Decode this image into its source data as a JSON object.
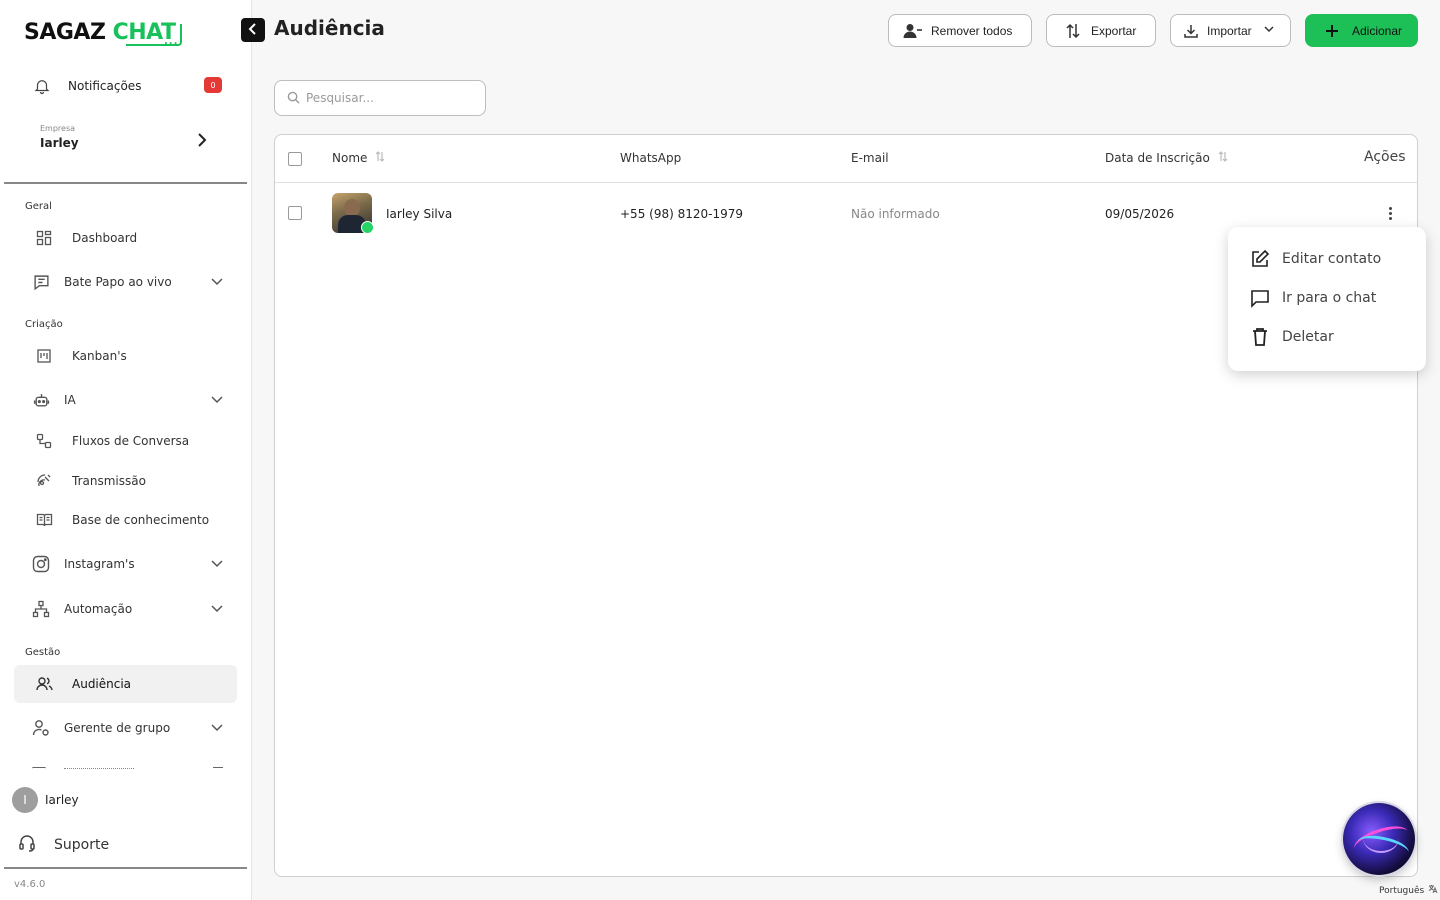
{
  "logo": {
    "part1": "SAGAZ",
    "part2": "CHAT",
    "dots": "..."
  },
  "notifications": {
    "label": "Notificações",
    "count": "0"
  },
  "company": {
    "caption": "Empresa",
    "name": "Iarley"
  },
  "sidebar": {
    "sections": {
      "geral": "Geral",
      "criacao": "Criação",
      "gestao": "Gestão"
    },
    "items": [
      {
        "label": "Dashboard",
        "icon": "dashboard-grid-icon"
      },
      {
        "label": "Bate Papo ao vivo",
        "icon": "chat-icon"
      },
      {
        "label": "Kanban's",
        "icon": "kanban-icon"
      },
      {
        "label": "IA",
        "icon": "robot-icon"
      },
      {
        "label": "Fluxos de Conversa",
        "icon": "flow-icon"
      },
      {
        "label": "Transmissão",
        "icon": "broadcast-icon"
      },
      {
        "label": "Base de conhecimento",
        "icon": "book-icon"
      },
      {
        "label": "Instagram's",
        "icon": "instagram-icon"
      },
      {
        "label": "Automação",
        "icon": "automation-icon"
      },
      {
        "label": "Audiência",
        "icon": "users-icon"
      },
      {
        "label": "Gerente de grupo",
        "icon": "group-manager-icon"
      }
    ]
  },
  "user": {
    "initial": "I",
    "name": "Iarley"
  },
  "support": {
    "label": "Suporte"
  },
  "version": "v4.6.0",
  "header": {
    "title": "Audiência"
  },
  "toolbar": {
    "remove_all": "Remover todos",
    "export": "Exportar",
    "import": "Importar",
    "add": "Adicionar"
  },
  "search": {
    "placeholder": "Pesquisar..."
  },
  "table": {
    "columns": [
      "Nome",
      "WhatsApp",
      "E-mail",
      "Data de Inscrição",
      "Ações"
    ],
    "rows": [
      {
        "name": "Iarley Silva",
        "whatsapp": "+55 (98) 8120-1979",
        "email": "Não informado",
        "date": "09/05/2026"
      }
    ]
  },
  "row_menu": {
    "items": [
      "Editar contato",
      "Ir para o chat",
      "Deletar"
    ]
  },
  "language": "Português",
  "colors": {
    "accent": "#1dbf57",
    "badge": "#e53935"
  }
}
